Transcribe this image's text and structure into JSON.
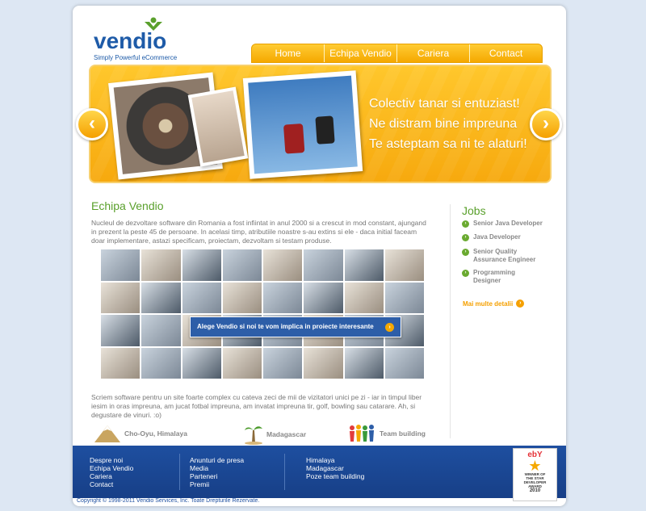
{
  "brand": {
    "name": "vendio",
    "tagline": "Simply Powerful eCommerce"
  },
  "nav": {
    "items": [
      "Home",
      "Echipa Vendio",
      "Cariera",
      "Contact"
    ]
  },
  "banner": {
    "lines": [
      "Colectiv tanar si entuziast!",
      "Ne distram bine impreuna",
      "Te asteptam sa ni te alaturi!"
    ],
    "prev_symbol": "‹",
    "next_symbol": "›"
  },
  "main": {
    "title": "Echipa Vendio",
    "intro": "Nucleul de dezvoltare software din Romania a fost infiintat in anul 2000 si a crescut in mod constant, ajungand in prezent la peste 45 de persoane. In acelasi timp, atributiile noastre s-au extins si ele - daca initial faceam doar implementare, astazi specificam, proiectam, dezvoltam si testam produse.",
    "cta": "Alege Vendio si noi te vom implica in proiecte interesante",
    "description": "Scriem software pentru un site foarte complex cu cateva zeci de mii de vizitatori unici pe zi - iar in timpul liber iesim in oras impreuna, am jucat fotbal impreuna, am invatat impreuna tir, golf, bowling sau catarare. Ah, si degustare de vinuri.  :o)",
    "features": [
      "Cho-Oyu, Himalaya",
      "Madagascar",
      "Team building"
    ]
  },
  "jobs": {
    "title": "Jobs",
    "items": [
      "Senior Java Developer",
      "Java Developer",
      "Senior Quality Assurance Engineer",
      "Programming Designer"
    ],
    "more": "Mai multe  detalii"
  },
  "footer": {
    "col1": [
      "Despre noi",
      "Echipa Vendio",
      "Cariera",
      "Contact"
    ],
    "col2": [
      "Anunturi de presa",
      "Media",
      "Parteneri",
      "Premii"
    ],
    "col3": [
      "Himalaya",
      "Madagascar",
      "Poze team building"
    ],
    "award": {
      "logo": "ebY",
      "lines": [
        "WINNER OF",
        "THE STAR",
        "DEVELOPER",
        "AWARD",
        "2010"
      ]
    },
    "copyright": "Copyright © 1998-2011 Vendio Services, Inc. Toate Drepturile Rezervate."
  },
  "colors": {
    "accent": "#f5a800",
    "green": "#5aa02c",
    "footer_blue": "#1e4fa0"
  }
}
